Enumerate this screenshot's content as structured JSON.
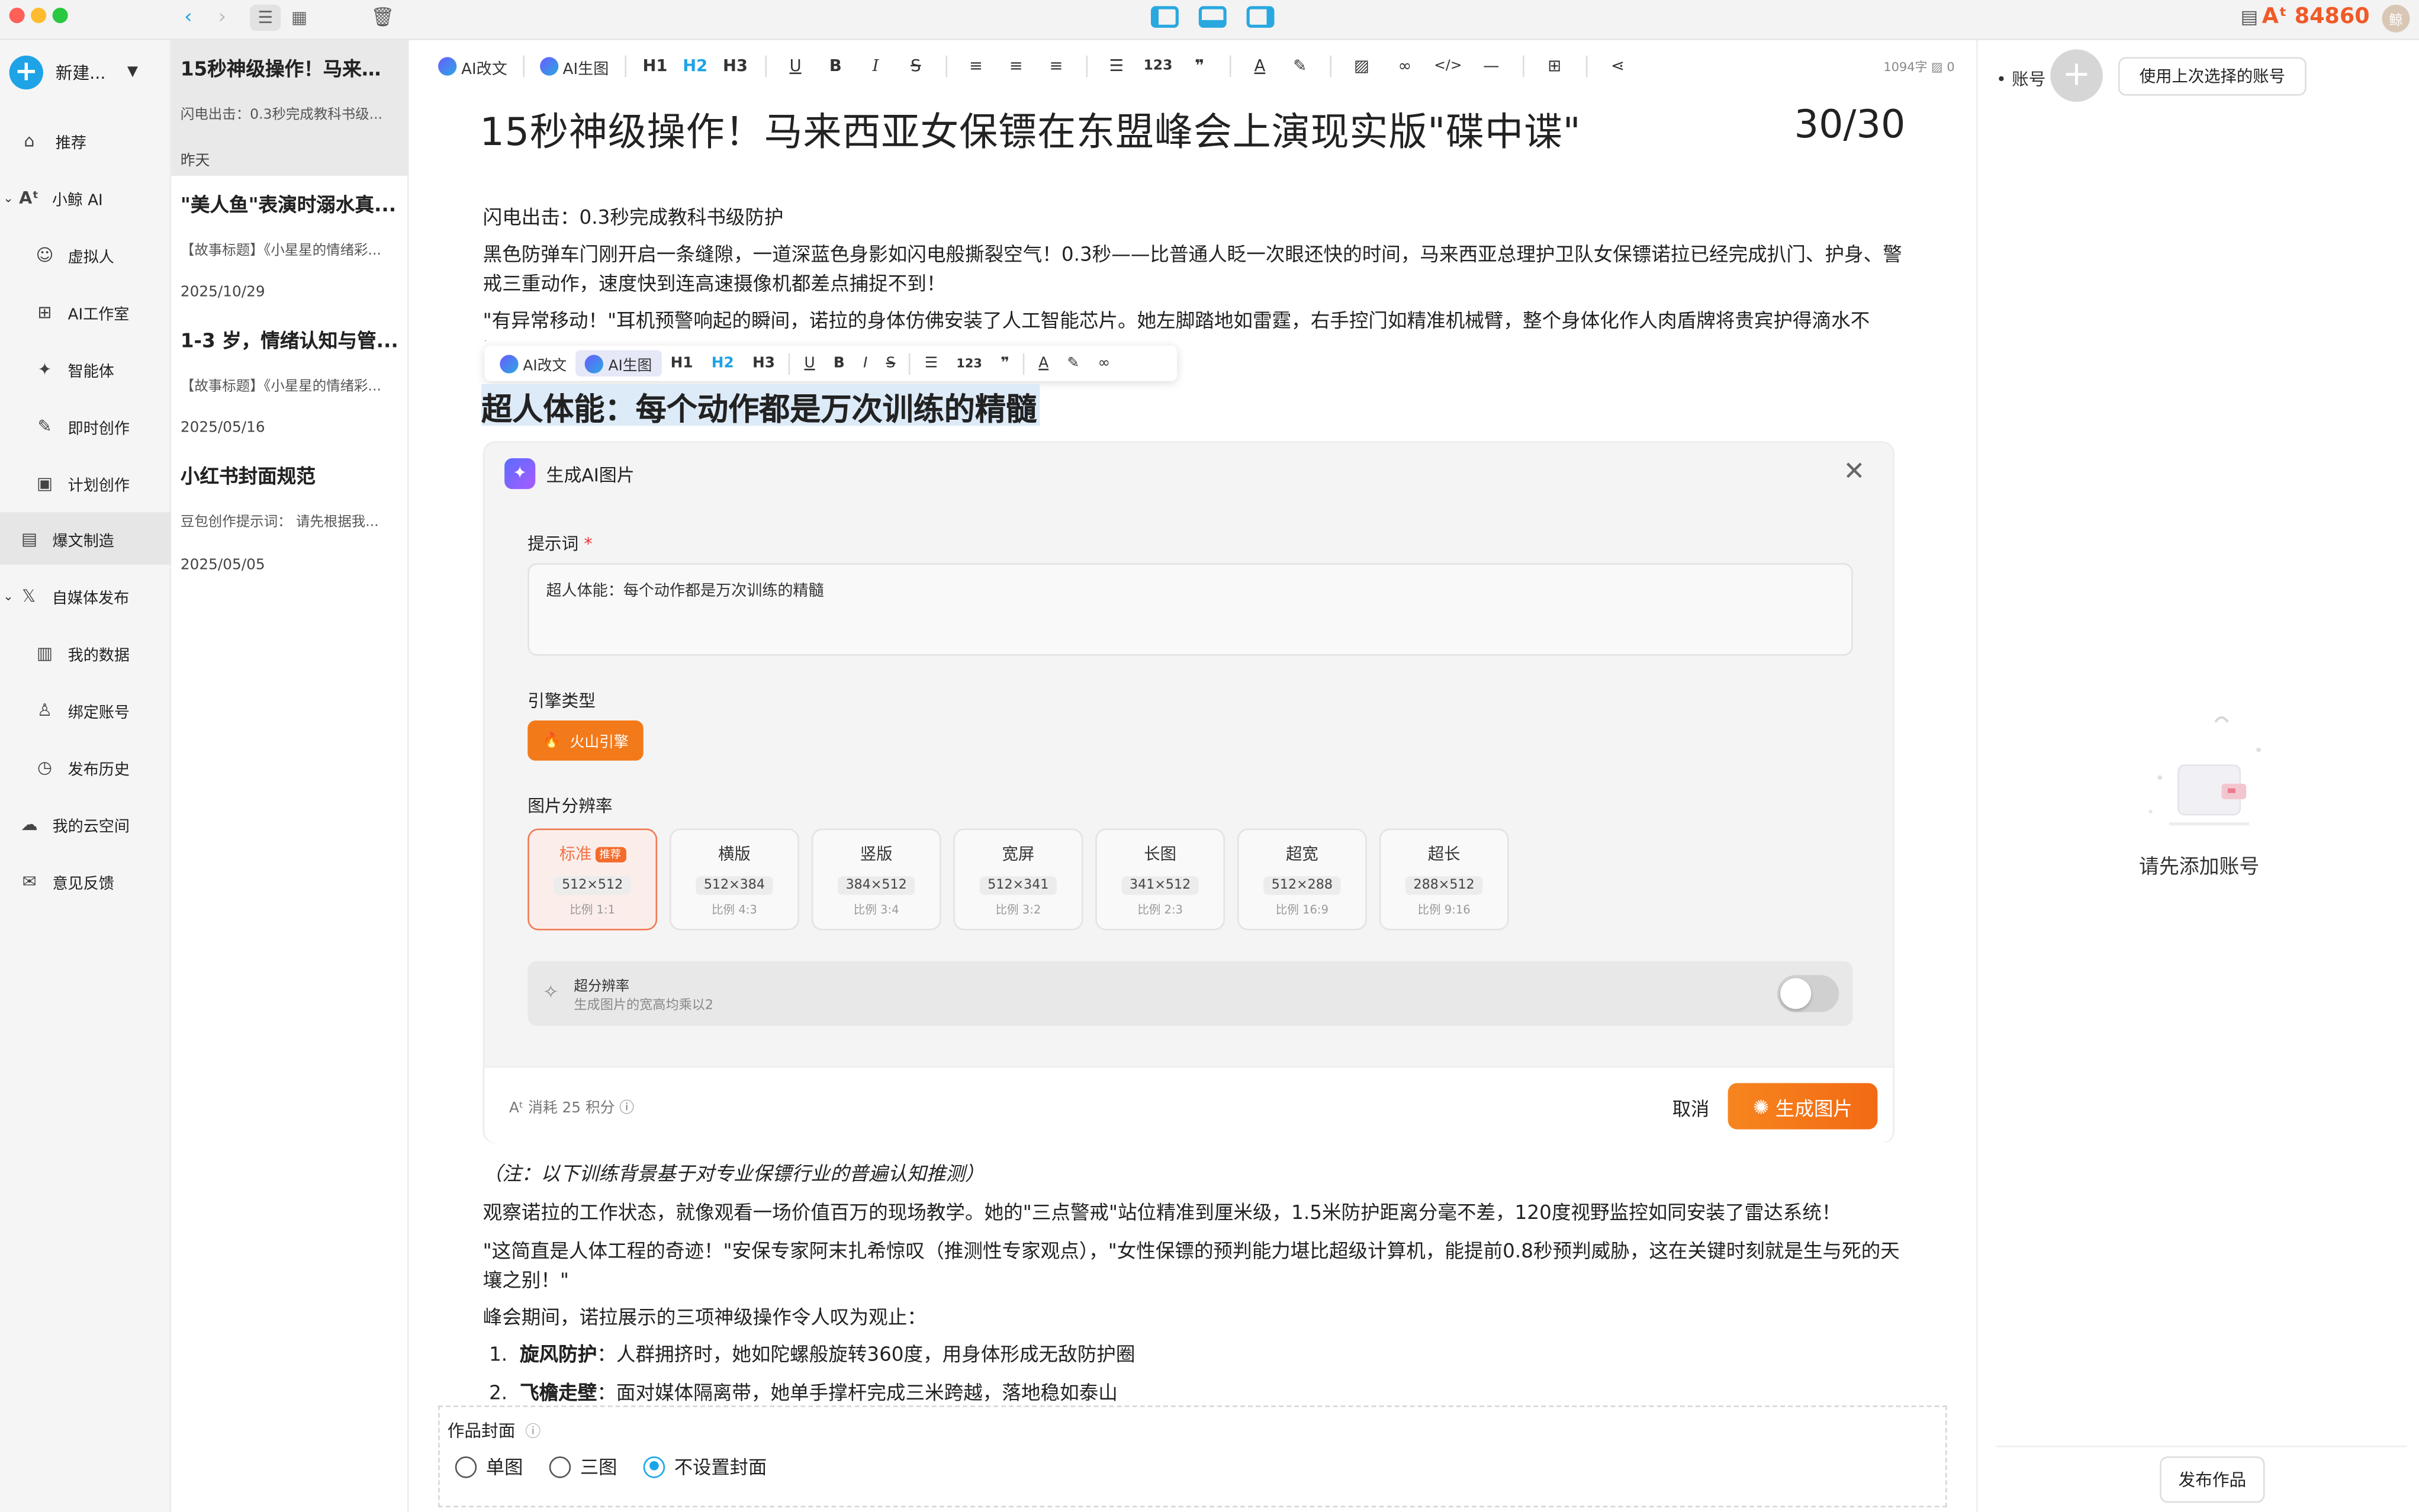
{
  "window": {
    "points_value": "84860",
    "ai_glyph": "Aᵗ",
    "avatar_text": "鲸"
  },
  "sidebar": {
    "new_label": "新建...",
    "items": [
      {
        "label": "推荐",
        "icon": "home-icon"
      },
      {
        "label": "小鲸 AI",
        "icon": "ai-icon"
      },
      {
        "label": "虚拟人",
        "icon": "avatar-icon"
      },
      {
        "label": "AI工作室",
        "icon": "grid-icon"
      },
      {
        "label": "智能体",
        "icon": "sparkle-icon"
      },
      {
        "label": "即时创作",
        "icon": "pen-icon"
      },
      {
        "label": "计划创作",
        "icon": "calendar-icon"
      },
      {
        "label": "爆文制造",
        "icon": "doc-icon"
      },
      {
        "label": "自媒体发布",
        "icon": "x-icon"
      },
      {
        "label": "我的数据",
        "icon": "chart-icon"
      },
      {
        "label": "绑定账号",
        "icon": "user-icon"
      },
      {
        "label": "发布历史",
        "icon": "clock-icon"
      },
      {
        "label": "我的云空间",
        "icon": "cloud-icon"
      },
      {
        "label": "意见反馈",
        "icon": "mail-icon"
      }
    ]
  },
  "articles": [
    {
      "title": "15秒神级操作！马来西...",
      "sub": "闪电出击：0.3秒完成教科书级...",
      "date": "昨天"
    },
    {
      "title": "\"美人鱼\"表演时溺水真...",
      "sub": "【故事标题】《小星星的情绪彩...",
      "date": "2025/10/29"
    },
    {
      "title": "1-3 岁，情绪认知与管...",
      "sub": "【故事标题】《小星星的情绪彩...",
      "date": "2025/05/16"
    },
    {
      "title": "小红书封面规范",
      "sub": "豆包创作提示词： 请先根据我...",
      "date": "2025/05/05"
    }
  ],
  "toolbar": {
    "ai_rewrite": "AI改文",
    "ai_image": "AI生图",
    "h1": "H1",
    "h2": "H2",
    "h3": "H3",
    "word_count": "1094字",
    "image_count": "0"
  },
  "editor": {
    "title": "15秒神级操作！马来西亚女保镖在东盟峰会上演现实版\"碟中谍\"",
    "title_counter": "30/30",
    "paragraphs_top": [
      "闪电出击：0.3秒完成教科书级防护",
      "黑色防弹车门刚开启一条缝隙，一道深蓝色身影如闪电般撕裂空气！0.3秒——比普通人眨一次眼还快的时间，马来西亚总理护卫队女保镖诺拉已经完成扒门、护身、警戒三重动作，速度快到连高速摄像机都差点捕捉不到！",
      "\"有异常移动！\"耳机预警响起的瞬间，诺拉的身体仿佛安装了人工智能芯片。她左脚踏地如雷霆，右手控门如精准机械臂，整个身体化作人肉盾牌将贵宾护得滴水不漏。"
    ],
    "selected_heading": "超人体能：每个动作都是万次训练的精髓",
    "note": "（注：以下训练背景基于对专业保镖行业的普遍认知推测）",
    "paragraphs_bottom": [
      "观察诺拉的工作状态，就像观看一场价值百万的现场教学。她的\"三点警戒\"站位精准到厘米级，1.5米防护距离分毫不差，120度视野监控如同安装了雷达系统！",
      "\"这简直是人体工程的奇迹！\"安保专家阿末扎希惊叹（推测性专家观点），\"女性保镖的预判能力堪比超级计算机，能提前0.8秒预判威胁，这在关键时刻就是生与死的天壤之别！\"",
      "峰会期间，诺拉展示的三项神级操作令人叹为观止："
    ],
    "list_items": [
      {
        "num": "1.",
        "bold": "旋风防护",
        "text": "：人群拥挤时，她如陀螺般旋转360度，用身体形成无敌防护圈"
      },
      {
        "num": "2.",
        "bold": "飞檐走壁",
        "text": "：面对媒体隔离带，她单手撑杆完成三米跨越，落地稳如泰山"
      }
    ]
  },
  "dialog": {
    "title": "生成AI图片",
    "prompt_label": "提示词",
    "prompt_required": "*",
    "prompt_value": "超人体能：每个动作都是万次训练的精髓",
    "engine_label": "引擎类型",
    "engine_value": "火山引擎",
    "resolution_label": "图片分辨率",
    "recommend_badge": "推荐",
    "resolutions": [
      {
        "name": "标准",
        "size": "512×512",
        "ratio": "比例 1:1"
      },
      {
        "name": "横版",
        "size": "512×384",
        "ratio": "比例 4:3"
      },
      {
        "name": "竖版",
        "size": "384×512",
        "ratio": "比例 3:4"
      },
      {
        "name": "宽屏",
        "size": "512×341",
        "ratio": "比例 3:2"
      },
      {
        "name": "长图",
        "size": "341×512",
        "ratio": "比例 2:3"
      },
      {
        "name": "超宽",
        "size": "512×288",
        "ratio": "比例 16:9"
      },
      {
        "name": "超长",
        "size": "288×512",
        "ratio": "比例 9:16"
      }
    ],
    "super_res_title": "超分辨率",
    "super_res_sub": "生成图片的宽高均乘以2",
    "cost": "消耗 25 积分",
    "cancel": "取消",
    "generate": "生成图片"
  },
  "cover": {
    "label": "作品封面",
    "options": [
      "单图",
      "三图",
      "不设置封面"
    ]
  },
  "right_panel": {
    "account_label": "账号",
    "use_last": "使用上次选择的账号",
    "empty_text": "请先添加账号",
    "publish": "发布作品"
  },
  "colors": {
    "accent_blue": "#1ea3e6",
    "accent_orange": "#f27a1a",
    "points_red": "#f05a28"
  }
}
